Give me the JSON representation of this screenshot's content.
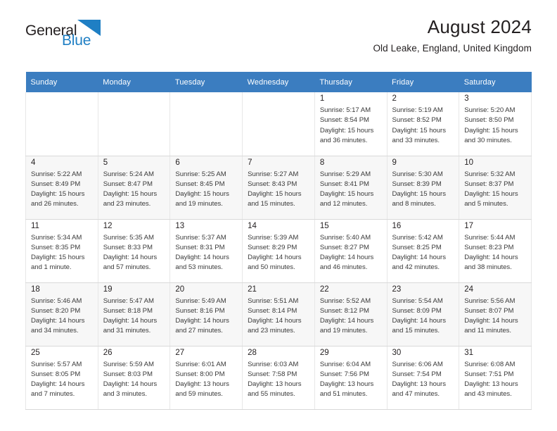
{
  "brand": {
    "name_part1": "General",
    "name_part2": "Blue",
    "logo_icon": "blue-triangle-icon",
    "colors": {
      "dark": "#231f20",
      "blue": "#1f7fc4"
    }
  },
  "header": {
    "title": "August 2024",
    "subtitle": "Old Leake, England, United Kingdom"
  },
  "calendar": {
    "header_bg": "#3b7dc0",
    "weekday_headers": [
      "Sunday",
      "Monday",
      "Tuesday",
      "Wednesday",
      "Thursday",
      "Friday",
      "Saturday"
    ],
    "weeks": [
      [
        {
          "day": "",
          "info": ""
        },
        {
          "day": "",
          "info": ""
        },
        {
          "day": "",
          "info": ""
        },
        {
          "day": "",
          "info": ""
        },
        {
          "day": "1",
          "info": "Sunrise: 5:17 AM\nSunset: 8:54 PM\nDaylight: 15 hours\nand 36 minutes."
        },
        {
          "day": "2",
          "info": "Sunrise: 5:19 AM\nSunset: 8:52 PM\nDaylight: 15 hours\nand 33 minutes."
        },
        {
          "day": "3",
          "info": "Sunrise: 5:20 AM\nSunset: 8:50 PM\nDaylight: 15 hours\nand 30 minutes."
        }
      ],
      [
        {
          "day": "4",
          "info": "Sunrise: 5:22 AM\nSunset: 8:49 PM\nDaylight: 15 hours\nand 26 minutes."
        },
        {
          "day": "5",
          "info": "Sunrise: 5:24 AM\nSunset: 8:47 PM\nDaylight: 15 hours\nand 23 minutes."
        },
        {
          "day": "6",
          "info": "Sunrise: 5:25 AM\nSunset: 8:45 PM\nDaylight: 15 hours\nand 19 minutes."
        },
        {
          "day": "7",
          "info": "Sunrise: 5:27 AM\nSunset: 8:43 PM\nDaylight: 15 hours\nand 15 minutes."
        },
        {
          "day": "8",
          "info": "Sunrise: 5:29 AM\nSunset: 8:41 PM\nDaylight: 15 hours\nand 12 minutes."
        },
        {
          "day": "9",
          "info": "Sunrise: 5:30 AM\nSunset: 8:39 PM\nDaylight: 15 hours\nand 8 minutes."
        },
        {
          "day": "10",
          "info": "Sunrise: 5:32 AM\nSunset: 8:37 PM\nDaylight: 15 hours\nand 5 minutes."
        }
      ],
      [
        {
          "day": "11",
          "info": "Sunrise: 5:34 AM\nSunset: 8:35 PM\nDaylight: 15 hours\nand 1 minute."
        },
        {
          "day": "12",
          "info": "Sunrise: 5:35 AM\nSunset: 8:33 PM\nDaylight: 14 hours\nand 57 minutes."
        },
        {
          "day": "13",
          "info": "Sunrise: 5:37 AM\nSunset: 8:31 PM\nDaylight: 14 hours\nand 53 minutes."
        },
        {
          "day": "14",
          "info": "Sunrise: 5:39 AM\nSunset: 8:29 PM\nDaylight: 14 hours\nand 50 minutes."
        },
        {
          "day": "15",
          "info": "Sunrise: 5:40 AM\nSunset: 8:27 PM\nDaylight: 14 hours\nand 46 minutes."
        },
        {
          "day": "16",
          "info": "Sunrise: 5:42 AM\nSunset: 8:25 PM\nDaylight: 14 hours\nand 42 minutes."
        },
        {
          "day": "17",
          "info": "Sunrise: 5:44 AM\nSunset: 8:23 PM\nDaylight: 14 hours\nand 38 minutes."
        }
      ],
      [
        {
          "day": "18",
          "info": "Sunrise: 5:46 AM\nSunset: 8:20 PM\nDaylight: 14 hours\nand 34 minutes."
        },
        {
          "day": "19",
          "info": "Sunrise: 5:47 AM\nSunset: 8:18 PM\nDaylight: 14 hours\nand 31 minutes."
        },
        {
          "day": "20",
          "info": "Sunrise: 5:49 AM\nSunset: 8:16 PM\nDaylight: 14 hours\nand 27 minutes."
        },
        {
          "day": "21",
          "info": "Sunrise: 5:51 AM\nSunset: 8:14 PM\nDaylight: 14 hours\nand 23 minutes."
        },
        {
          "day": "22",
          "info": "Sunrise: 5:52 AM\nSunset: 8:12 PM\nDaylight: 14 hours\nand 19 minutes."
        },
        {
          "day": "23",
          "info": "Sunrise: 5:54 AM\nSunset: 8:09 PM\nDaylight: 14 hours\nand 15 minutes."
        },
        {
          "day": "24",
          "info": "Sunrise: 5:56 AM\nSunset: 8:07 PM\nDaylight: 14 hours\nand 11 minutes."
        }
      ],
      [
        {
          "day": "25",
          "info": "Sunrise: 5:57 AM\nSunset: 8:05 PM\nDaylight: 14 hours\nand 7 minutes."
        },
        {
          "day": "26",
          "info": "Sunrise: 5:59 AM\nSunset: 8:03 PM\nDaylight: 14 hours\nand 3 minutes."
        },
        {
          "day": "27",
          "info": "Sunrise: 6:01 AM\nSunset: 8:00 PM\nDaylight: 13 hours\nand 59 minutes."
        },
        {
          "day": "28",
          "info": "Sunrise: 6:03 AM\nSunset: 7:58 PM\nDaylight: 13 hours\nand 55 minutes."
        },
        {
          "day": "29",
          "info": "Sunrise: 6:04 AM\nSunset: 7:56 PM\nDaylight: 13 hours\nand 51 minutes."
        },
        {
          "day": "30",
          "info": "Sunrise: 6:06 AM\nSunset: 7:54 PM\nDaylight: 13 hours\nand 47 minutes."
        },
        {
          "day": "31",
          "info": "Sunrise: 6:08 AM\nSunset: 7:51 PM\nDaylight: 13 hours\nand 43 minutes."
        }
      ]
    ]
  }
}
